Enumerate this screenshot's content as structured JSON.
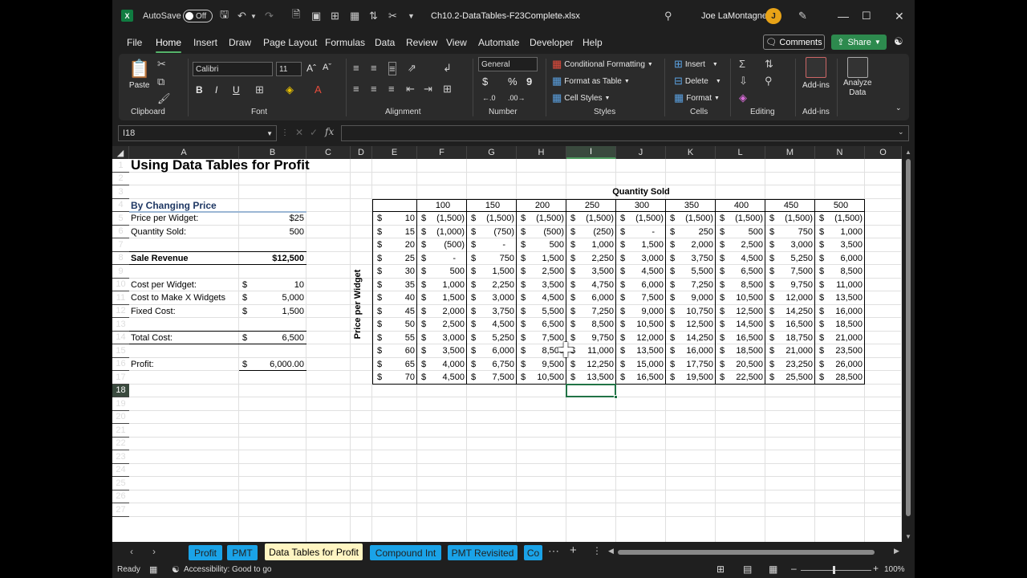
{
  "titlebar": {
    "autosave_label": "AutoSave",
    "autosave_state": "Off",
    "filename": "Ch10.2-DataTables-F23Complete.xlsx",
    "user": "Joe LaMontagne"
  },
  "menu": [
    "File",
    "Home",
    "Insert",
    "Draw",
    "Page Layout",
    "Formulas",
    "Data",
    "Review",
    "View",
    "Automate",
    "Developer",
    "Help"
  ],
  "menu_active": "Home",
  "actions": {
    "comments": "Comments",
    "share": "Share"
  },
  "ribbon": {
    "clipboard": {
      "paste": "Paste",
      "label": "Clipboard"
    },
    "font": {
      "name": "Calibri",
      "size": "11",
      "label": "Font"
    },
    "alignment": {
      "label": "Alignment"
    },
    "number": {
      "format": "General",
      "label": "Number"
    },
    "styles": {
      "conditional": "Conditional Formatting",
      "format_table": "Format as Table",
      "cell_styles": "Cell Styles",
      "label": "Styles"
    },
    "cells": {
      "insert": "Insert",
      "delete": "Delete",
      "format": "Format",
      "label": "Cells"
    },
    "editing": {
      "label": "Editing"
    },
    "addins": {
      "addins": "Add-ins",
      "label": "Add-ins"
    },
    "analyze": {
      "line1": "Analyze",
      "line2": "Data"
    }
  },
  "formula_bar": {
    "name_box": "I18",
    "fx": "fx",
    "formula": ""
  },
  "columns": [
    "A",
    "B",
    "C",
    "D",
    "E",
    "F",
    "G",
    "H",
    "I",
    "J",
    "K",
    "L",
    "M",
    "N",
    "O"
  ],
  "selected_column": "I",
  "selected_row": "18",
  "rows": [
    "1",
    "2",
    "3",
    "4",
    "5",
    "6",
    "7",
    "8",
    "9",
    "10",
    "11",
    "12",
    "13",
    "14",
    "15",
    "16",
    "17",
    "18",
    "19",
    "20",
    "21",
    "22",
    "23",
    "24",
    "25",
    "26",
    "27"
  ],
  "sheet": {
    "title": "Using  Data Tables for Profit",
    "section": "By Changing Price",
    "labels": {
      "r5": "Price per Widget:",
      "r6": "Quantity Sold:",
      "r8": "Sale Revenue",
      "r10": "Cost per Widget:",
      "r11": "Cost to Make X Widgets",
      "r12": "Fixed Cost:",
      "r14": "Total Cost:",
      "r16": "Profit:"
    },
    "values": {
      "b5": "$25",
      "b6": "500",
      "b8": "$12,500",
      "b10": "10",
      "b11": "5,000",
      "b12": "1,500",
      "b14": "6,500",
      "b16": "6,000.00"
    },
    "dollar": "$",
    "table_title": "Quantity Sold",
    "side_title": "Price per Widget",
    "quantities": [
      "100",
      "150",
      "200",
      "250",
      "300",
      "350",
      "400",
      "450",
      "500"
    ],
    "prices": [
      "10",
      "15",
      "20",
      "25",
      "30",
      "35",
      "40",
      "45",
      "50",
      "55",
      "60",
      "65",
      "70"
    ],
    "table": [
      [
        "(1,500)",
        "(1,500)",
        "(1,500)",
        "(1,500)",
        "(1,500)",
        "(1,500)",
        "(1,500)",
        "(1,500)",
        "(1,500)"
      ],
      [
        "(1,000)",
        "(750)",
        "(500)",
        "(250)",
        "-",
        "250",
        "500",
        "750",
        "1,000"
      ],
      [
        "(500)",
        "-",
        "500",
        "1,000",
        "1,500",
        "2,000",
        "2,500",
        "3,000",
        "3,500"
      ],
      [
        "-",
        "750",
        "1,500",
        "2,250",
        "3,000",
        "3,750",
        "4,500",
        "5,250",
        "6,000"
      ],
      [
        "500",
        "1,500",
        "2,500",
        "3,500",
        "4,500",
        "5,500",
        "6,500",
        "7,500",
        "8,500"
      ],
      [
        "1,000",
        "2,250",
        "3,500",
        "4,750",
        "6,000",
        "7,250",
        "8,500",
        "9,750",
        "11,000"
      ],
      [
        "1,500",
        "3,000",
        "4,500",
        "6,000",
        "7,500",
        "9,000",
        "10,500",
        "12,000",
        "13,500"
      ],
      [
        "2,000",
        "3,750",
        "5,500",
        "7,250",
        "9,000",
        "10,750",
        "12,500",
        "14,250",
        "16,000"
      ],
      [
        "2,500",
        "4,500",
        "6,500",
        "8,500",
        "10,500",
        "12,500",
        "14,500",
        "16,500",
        "18,500"
      ],
      [
        "3,000",
        "5,250",
        "7,500",
        "9,750",
        "12,000",
        "14,250",
        "16,500",
        "18,750",
        "21,000"
      ],
      [
        "3,500",
        "6,000",
        "8,500",
        "11,000",
        "13,500",
        "16,000",
        "18,500",
        "21,000",
        "23,500"
      ],
      [
        "4,000",
        "6,750",
        "9,500",
        "12,250",
        "15,000",
        "17,750",
        "20,500",
        "23,250",
        "26,000"
      ],
      [
        "4,500",
        "7,500",
        "10,500",
        "13,500",
        "16,500",
        "19,500",
        "22,500",
        "25,500",
        "28,500"
      ]
    ]
  },
  "sheet_tabs": [
    "Profit",
    "PMT",
    "Data Tables for Profit",
    "Compound Int",
    "PMT Revisited",
    "Co"
  ],
  "active_tab": "Data Tables for Profit",
  "status": {
    "ready": "Ready",
    "accessibility": "Accessibility: Good to go",
    "zoom": "100%"
  }
}
